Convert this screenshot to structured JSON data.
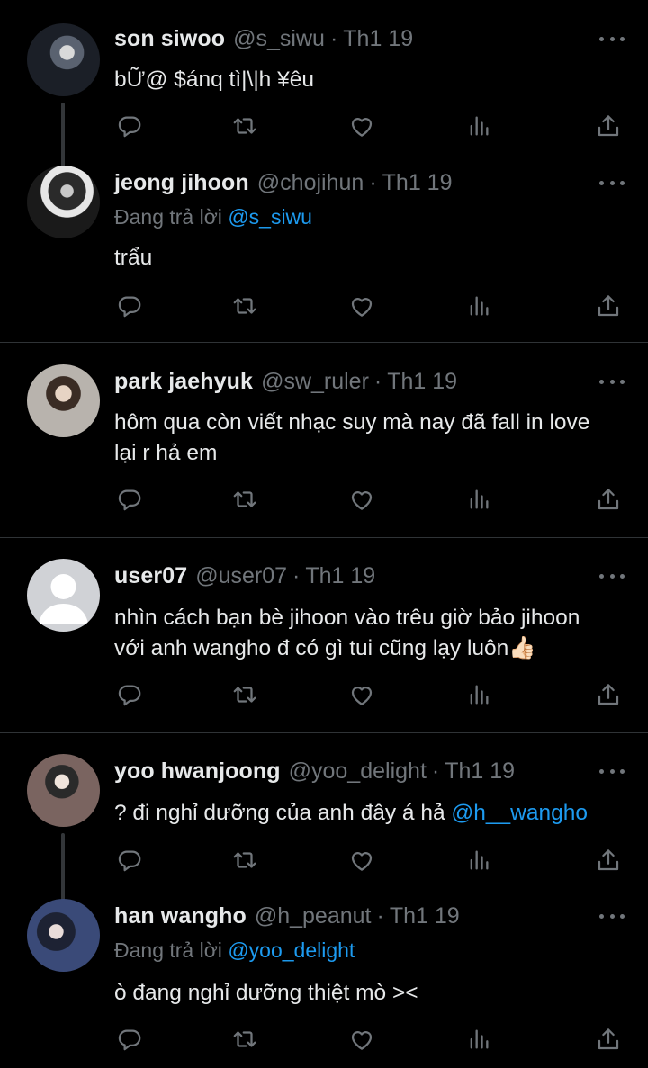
{
  "tweets": [
    {
      "name": "son siwoo",
      "handle": "@s_siwu",
      "separator": "·",
      "date": "Th1 19",
      "replying_to_label": "",
      "replying_to": "",
      "text": "bỮ@ $ánq tì|\\|h ¥êu"
    },
    {
      "name": "jeong jihoon",
      "handle": "@chojihun",
      "separator": "·",
      "date": "Th1 19",
      "replying_to_label": "Đang trả lời",
      "replying_to": "@s_siwu",
      "text": "trẩu"
    },
    {
      "name": "park jaehyuk",
      "handle": "@sw_ruler",
      "separator": "·",
      "date": "Th1 19",
      "replying_to_label": "",
      "replying_to": "",
      "text_line1": "hôm qua còn viết nhạc suy mà nay đã fall in love",
      "text_line2": "lại r hả em"
    },
    {
      "name": "user07",
      "handle": "@user07",
      "separator": "·",
      "date": "Th1 19",
      "replying_to_label": "",
      "replying_to": "",
      "text_line1": "nhìn cách bạn bè jihoon vào trêu giờ bảo jihoon",
      "text_line2": "với anh wangho đ có gì tui cũng lạy luôn👍🏻"
    },
    {
      "name": "yoo hwanjoong",
      "handle": "@yoo_delight",
      "separator": "·",
      "date": "Th1 19",
      "replying_to_label": "",
      "replying_to": "",
      "text": "? đi nghỉ dưỡng của anh đây á hả ",
      "mention": "@h__wangho"
    },
    {
      "name": "han wangho",
      "handle": "@h_peanut",
      "separator": "·",
      "date": "Th1 19",
      "replying_to_label": "Đang trả lời",
      "replying_to": "@yoo_delight",
      "text": "ò đang nghỉ dưỡng thiệt mò ><"
    }
  ],
  "colors": {
    "background": "#000000",
    "text_primary": "#e7e9ea",
    "text_secondary": "#71767b",
    "link": "#1d9bf0",
    "divider": "#2f3336"
  },
  "icons": [
    "reply-icon",
    "retweet-icon",
    "like-icon",
    "views-icon",
    "share-icon",
    "more-icon"
  ]
}
